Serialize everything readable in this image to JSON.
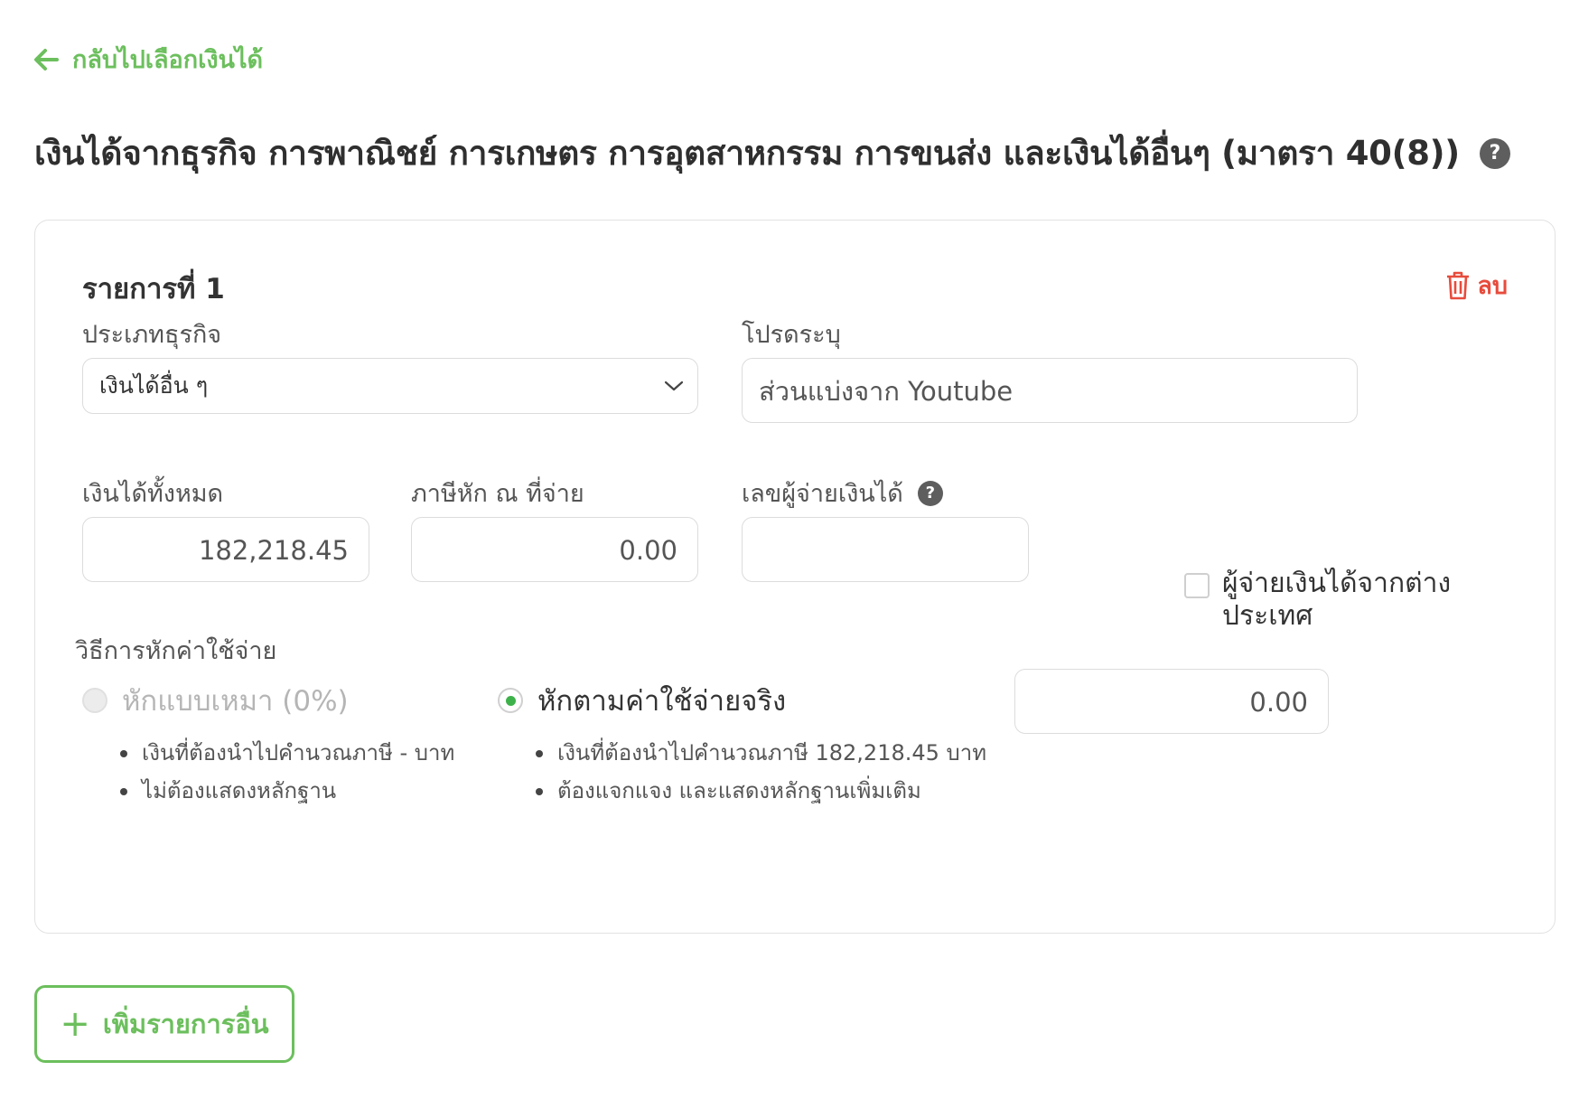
{
  "nav": {
    "back_label": "กลับไปเลือกเงินได้"
  },
  "page": {
    "title": "เงินได้จากธุรกิจ การพาณิชย์ การเกษตร การอุตสาหกรรม การขนส่ง และเงินได้อื่นๆ (มาตรา 40(8))",
    "help_glyph": "?"
  },
  "item": {
    "title": "รายการที่ 1",
    "delete_label": "ลบ",
    "business_type": {
      "label": "ประเภทธุรกิจ",
      "value": "เงินได้อื่น ๆ"
    },
    "specify": {
      "label": "โปรดระบุ",
      "value": "ส่วนแบ่งจาก Youtube"
    },
    "total_income": {
      "label": "เงินได้ทั้งหมด",
      "value": "182,218.45"
    },
    "withholding_tax": {
      "label": "ภาษีหัก ณ ที่จ่าย",
      "value": "0.00"
    },
    "payer_id": {
      "label": "เลขผู้จ่ายเงินได้",
      "value": "",
      "help_glyph": "?"
    },
    "foreign_payer": {
      "label": "ผู้จ่ายเงินได้จากต่างประเทศ",
      "checked": false
    },
    "deduction": {
      "label": "วิธีการหักค่าใช้จ่าย",
      "options": [
        {
          "label": "หักแบบเหมา (0%)",
          "selected": false,
          "disabled": true,
          "notes": [
            "เงินที่ต้องนำไปคำนวณภาษี - บาท",
            "ไม่ต้องแสดงหลักฐาน"
          ]
        },
        {
          "label": "หักตามค่าใช้จ่ายจริง",
          "selected": true,
          "disabled": false,
          "notes": [
            "เงินที่ต้องนำไปคำนวณภาษี 182,218.45 บาท",
            "ต้องแจกแจง และแสดงหลักฐานเพิ่มเติม"
          ]
        }
      ],
      "actual_amount": "0.00"
    }
  },
  "add_button": {
    "icon": "+",
    "label": "เพิ่มรายการอื่น"
  },
  "colors": {
    "accent": "#6cbf5d",
    "danger": "#e74c3c",
    "radio_selected": "#3db24a"
  }
}
